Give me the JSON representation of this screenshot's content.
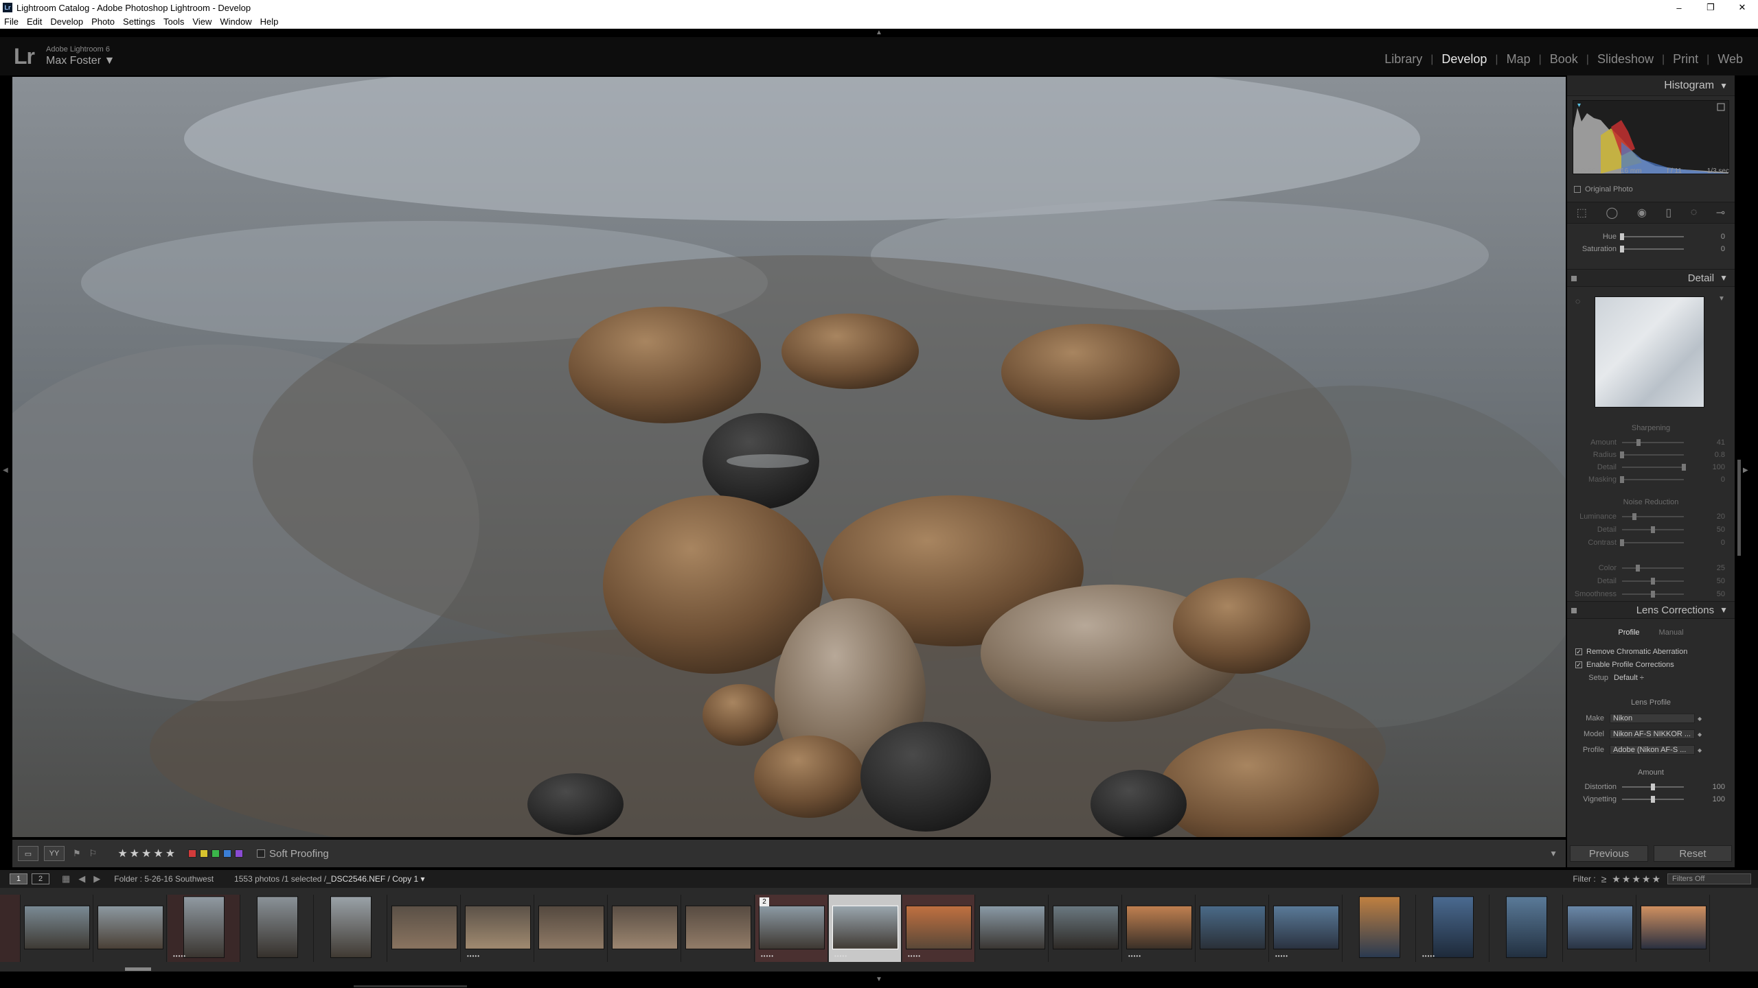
{
  "window": {
    "title": "Lightroom Catalog - Adobe Photoshop Lightroom - Develop",
    "controls": [
      "–",
      "❐",
      "✕"
    ]
  },
  "menu": [
    "File",
    "Edit",
    "Develop",
    "Photo",
    "Settings",
    "Tools",
    "View",
    "Window",
    "Help"
  ],
  "identity": {
    "logo": "Lr",
    "product": "Adobe Lightroom 6",
    "user": "Max Foster ▼"
  },
  "modules": [
    "Library",
    "Develop",
    "Map",
    "Book",
    "Slideshow",
    "Print",
    "Web"
  ],
  "active_module": "Develop",
  "toolbar": {
    "stars": "★★★★★",
    "soft_proofing": "Soft Proofing",
    "view_label": "YY",
    "color_labels": [
      "#d23b3b",
      "#d8c32e",
      "#3bb54a",
      "#3b7fd6",
      "#8a4bd2"
    ]
  },
  "histogram": {
    "title": "Histogram",
    "iso": "ISO 50",
    "focal": "16 mm",
    "aperture": "f / 11",
    "shutter": "1/3 sec",
    "original_photo": "Original Photo"
  },
  "hsl": {
    "hue": {
      "label": "Hue",
      "value": "0",
      "pos": 0.0
    },
    "saturation": {
      "label": "Saturation",
      "value": "0",
      "pos": 0.0
    }
  },
  "detail": {
    "title": "Detail",
    "sharpening": "Sharpening",
    "sharp_sliders": [
      {
        "label": "Amount",
        "value": "41",
        "pos": 0.27
      },
      {
        "label": "Radius",
        "value": "0.8",
        "pos": 0.0
      },
      {
        "label": "Detail",
        "value": "100",
        "pos": 1.0
      },
      {
        "label": "Masking",
        "value": "0",
        "pos": 0.0
      }
    ],
    "noise": "Noise Reduction",
    "noise_sliders": [
      {
        "label": "Luminance",
        "value": "20",
        "pos": 0.2
      },
      {
        "label": "Detail",
        "value": "50",
        "pos": 0.5
      },
      {
        "label": "Contrast",
        "value": "0",
        "pos": 0.0
      },
      {
        "label": "Color",
        "value": "25",
        "pos": 0.25
      },
      {
        "label": "Detail",
        "value": "50",
        "pos": 0.5
      },
      {
        "label": "Smoothness",
        "value": "50",
        "pos": 0.5
      }
    ]
  },
  "lens": {
    "title": "Lens Corrections",
    "tabs": [
      "Profile",
      "Manual"
    ],
    "remove_ca": "Remove Chromatic Aberration",
    "enable_profile": "Enable Profile Corrections",
    "setup_label": "Setup",
    "setup_value": "Default ÷",
    "lens_profile": "Lens Profile",
    "make_label": "Make",
    "make": "Nikon",
    "model_label": "Model",
    "model": "Nikon AF-S NIKKOR ...",
    "profile_label": "Profile",
    "profile": "Adobe (Nikon AF-S ...",
    "amount": "Amount",
    "distortion": {
      "label": "Distortion",
      "value": "100",
      "pos": 0.5
    },
    "vignetting": {
      "label": "Vignetting",
      "value": "100",
      "pos": 0.5
    }
  },
  "buttons": {
    "previous": "Previous",
    "reset": "Reset"
  },
  "filmbar": {
    "monitors": [
      "1",
      "2"
    ],
    "folder": "Folder : 5-26-16 Southwest",
    "count": "1553 photos /1 selected /",
    "filename": "_DSC2546.NEF / Copy 1 ▾",
    "filter_label": "Filter :",
    "filter_stars": "≥ ★★★★★",
    "filter_value": "Filters Off"
  },
  "thumb_badge": "2"
}
